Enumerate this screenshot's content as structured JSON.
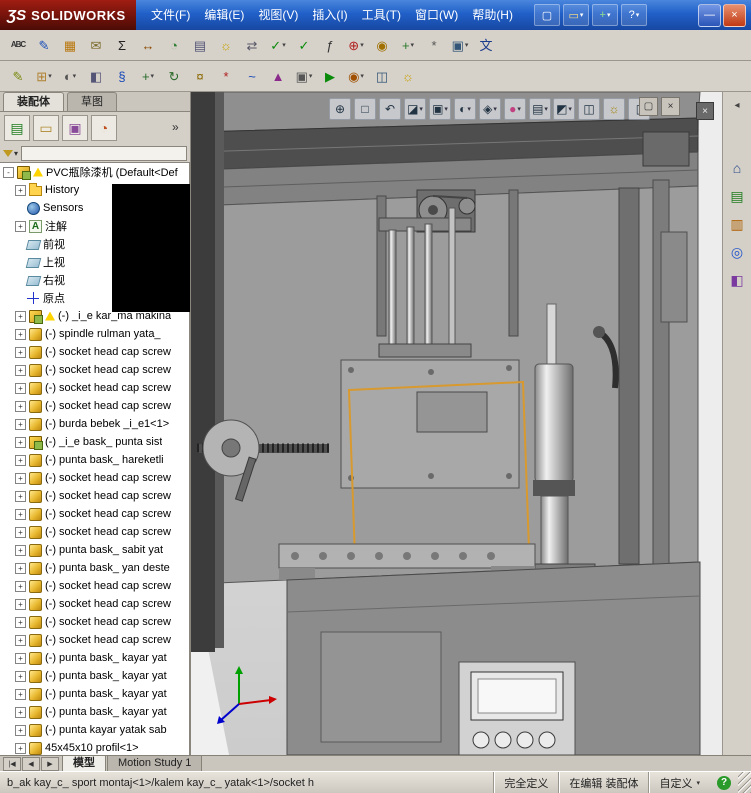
{
  "app": {
    "logo_mark": "ƷS",
    "logo_text": "SOLIDWORKS"
  },
  "title_bar": {
    "menus": [
      "文件(F)",
      "编辑(E)",
      "视图(V)",
      "插入(I)",
      "工具(T)",
      "窗口(W)",
      "帮助(H)"
    ],
    "quick_icons": [
      {
        "name": "new-document-icon",
        "glyph": "▢",
        "fg": "#ffffff"
      },
      {
        "name": "open-document-icon",
        "glyph": "▭",
        "fg": "#ffe080",
        "dd": true
      },
      {
        "name": "toolbox-icon",
        "glyph": "+",
        "fg": "#8fe08f",
        "dd": true
      },
      {
        "name": "help-icon",
        "glyph": "?",
        "fg": "#ffffff",
        "dd": true
      }
    ],
    "window_buttons": [
      {
        "name": "minimize-button",
        "glyph": "—"
      },
      {
        "name": "close-button",
        "glyph": "×",
        "close": true
      }
    ]
  },
  "toolbars": {
    "row1": [
      {
        "name": "spell-check-icon",
        "glyph": "ABC",
        "fg": "#333333",
        "cls": "small"
      },
      {
        "name": "sketch-icon",
        "glyph": "✎",
        "fg": "#1d4fb8"
      },
      {
        "name": "design-table-icon",
        "glyph": "▦",
        "fg": "#b9770e"
      },
      {
        "name": "publish-edrawing-icon",
        "glyph": "✉",
        "fg": "#7a6a2a"
      },
      {
        "name": "equations-icon",
        "glyph": "Σ",
        "fg": "#222222"
      },
      {
        "name": "measure-icon",
        "glyph": "↔",
        "fg": "#8a4a00"
      },
      {
        "name": "mass-properties-icon",
        "glyph": "◔",
        "fg": "#2e7d32"
      },
      {
        "name": "section-properties-icon",
        "glyph": "▤",
        "fg": "#555577"
      },
      {
        "name": "lights-icon",
        "glyph": "☼",
        "fg": "#c8a000"
      },
      {
        "name": "reorder-icon",
        "glyph": "⇄",
        "fg": "#555566"
      },
      {
        "name": "design-check-icon",
        "glyph": "✓",
        "fg": "#0a8a0a",
        "dd": true
      },
      {
        "name": "verify-sketch-icon",
        "glyph": "✓",
        "fg": "#0a8a0a"
      },
      {
        "name": "statistics-icon",
        "glyph": "ƒ",
        "fg": "#333333"
      },
      {
        "name": "simulation-icon",
        "glyph": "⊕",
        "fg": "#b02020",
        "dd": true
      },
      {
        "name": "sensor-icon",
        "glyph": "◉",
        "fg": "#a07000"
      },
      {
        "name": "move-face-icon",
        "glyph": "+",
        "fg": "#2a7a2a",
        "dd": true
      },
      {
        "name": "options-gear-icon",
        "glyph": "*",
        "fg": "#555555"
      },
      {
        "name": "deviation-icon",
        "glyph": "▣",
        "fg": "#335577",
        "dd": true
      },
      {
        "name": "language-icon",
        "glyph": "文",
        "fg": "#1a3a8a"
      }
    ],
    "row2": [
      {
        "name": "edit-component-icon",
        "glyph": "✎",
        "fg": "#7a8a10"
      },
      {
        "name": "insert-component-icon",
        "glyph": "⊞",
        "fg": "#b08030",
        "dd": true
      },
      {
        "name": "hide-component-icon",
        "glyph": "◐",
        "fg": "#555555",
        "dd": true
      },
      {
        "name": "component-transparency-icon",
        "glyph": "◧",
        "fg": "#555577"
      },
      {
        "name": "mate-icon",
        "glyph": "§",
        "fg": "#1a4ab8"
      },
      {
        "name": "move-component-icon",
        "glyph": "+",
        "fg": "#2a6a2a",
        "dd": true
      },
      {
        "name": "rotate-component-icon",
        "glyph": "↻",
        "fg": "#2a6a2a"
      },
      {
        "name": "smart-fasteners-icon",
        "glyph": "¤",
        "fg": "#8a6a00"
      },
      {
        "name": "exploded-view-icon",
        "glyph": "*",
        "fg": "#b02020"
      },
      {
        "name": "explode-lines-icon",
        "glyph": "~",
        "fg": "#1a4ab8"
      },
      {
        "name": "interference-detection-icon",
        "glyph": "▲",
        "fg": "#8a2a8a"
      },
      {
        "name": "assembly-features-icon",
        "glyph": "▣",
        "fg": "#555555",
        "dd": true
      },
      {
        "name": "motion-study-icon",
        "glyph": "▶",
        "fg": "#0a8a0a"
      },
      {
        "name": "physical-simulation-icon",
        "glyph": "◉",
        "fg": "#a05000",
        "dd": true
      },
      {
        "name": "camera-view-icon",
        "glyph": "◫",
        "fg": "#335577"
      },
      {
        "name": "scene-light-icon",
        "glyph": "☼",
        "fg": "#c8a000"
      }
    ]
  },
  "left_panel": {
    "tabs": [
      {
        "label": "装配体",
        "active": true
      },
      {
        "label": "草图",
        "active": false
      }
    ],
    "manager_tabs": [
      {
        "name": "featuremanager-tree-tab",
        "glyph": "▤",
        "fg": "#1e7d1e"
      },
      {
        "name": "propertymanager-tab",
        "glyph": "▭",
        "fg": "#b08a30"
      },
      {
        "name": "configurationmanager-tab",
        "glyph": "▣",
        "fg": "#8a4a9a"
      },
      {
        "name": "dimxpert-tab",
        "glyph": "◔",
        "fg": "#c05020"
      }
    ],
    "chevron": "»",
    "filter": {
      "dd": "▾"
    },
    "tree": {
      "items": [
        {
          "ind": "ind0",
          "expc": "ebox",
          "exp": "-",
          "icon": "assembly",
          "warn": true,
          "label": "PVC瓶除漆机  (Default<Def"
        },
        {
          "ind": "ind1",
          "expc": "ebox",
          "exp": "+",
          "icon": "folder",
          "label": "History"
        },
        {
          "ind": "ind1",
          "expc": "enone",
          "exp": "",
          "icon": "sensors",
          "label": "Sensors"
        },
        {
          "ind": "ind1",
          "expc": "ebox",
          "exp": "+",
          "icon": "annotation",
          "label": "注解"
        },
        {
          "ind": "ind1",
          "expc": "enone",
          "exp": "",
          "icon": "plane",
          "label": "前视"
        },
        {
          "ind": "ind1",
          "expc": "enone",
          "exp": "",
          "icon": "plane",
          "label": "上视"
        },
        {
          "ind": "ind1",
          "expc": "enone",
          "exp": "",
          "icon": "plane",
          "label": "右视"
        },
        {
          "ind": "ind1",
          "expc": "enone",
          "exp": "",
          "icon": "origin",
          "label": "原点"
        },
        {
          "ind": "ind1",
          "expc": "ebox",
          "exp": "+",
          "icon": "assembly",
          "warn": true,
          "label": "(-) _i_e kar_ma makina"
        },
        {
          "ind": "ind1",
          "expc": "ebox",
          "exp": "+",
          "icon": "part",
          "label": "(-) spindle rulman yata_"
        },
        {
          "ind": "ind1",
          "expc": "ebox",
          "exp": "+",
          "icon": "part",
          "label": "(-) socket head cap screw"
        },
        {
          "ind": "ind1",
          "expc": "ebox",
          "exp": "+",
          "icon": "part",
          "label": "(-) socket head cap screw"
        },
        {
          "ind": "ind1",
          "expc": "ebox",
          "exp": "+",
          "icon": "part",
          "label": "(-) socket head cap screw"
        },
        {
          "ind": "ind1",
          "expc": "ebox",
          "exp": "+",
          "icon": "part",
          "label": "(-) socket head cap screw"
        },
        {
          "ind": "ind1",
          "expc": "ebox",
          "exp": "+",
          "icon": "part",
          "label": "(-) burda bebek _i_e1<1>"
        },
        {
          "ind": "ind1",
          "expc": "ebox",
          "exp": "+",
          "icon": "assembly",
          "label": "(-) _i_e bask_ punta sist"
        },
        {
          "ind": "ind1",
          "expc": "ebox",
          "exp": "+",
          "icon": "part",
          "label": "(-) punta bask_ hareketli"
        },
        {
          "ind": "ind1",
          "expc": "ebox",
          "exp": "+",
          "icon": "part",
          "label": "(-) socket head cap screw"
        },
        {
          "ind": "ind1",
          "expc": "ebox",
          "exp": "+",
          "icon": "part",
          "label": "(-) socket head cap screw"
        },
        {
          "ind": "ind1",
          "expc": "ebox",
          "exp": "+",
          "icon": "part",
          "label": "(-) socket head cap screw"
        },
        {
          "ind": "ind1",
          "expc": "ebox",
          "exp": "+",
          "icon": "part",
          "label": "(-) socket head cap screw"
        },
        {
          "ind": "ind1",
          "expc": "ebox",
          "exp": "+",
          "icon": "part",
          "label": "(-) punta bask_ sabit yat"
        },
        {
          "ind": "ind1",
          "expc": "ebox",
          "exp": "+",
          "icon": "part",
          "label": "(-) punta bask_ yan deste"
        },
        {
          "ind": "ind1",
          "expc": "ebox",
          "exp": "+",
          "icon": "part",
          "label": "(-) socket head cap screw"
        },
        {
          "ind": "ind1",
          "expc": "ebox",
          "exp": "+",
          "icon": "part",
          "label": "(-) socket head cap screw"
        },
        {
          "ind": "ind1",
          "expc": "ebox",
          "exp": "+",
          "icon": "part",
          "label": "(-) socket head cap screw"
        },
        {
          "ind": "ind1",
          "expc": "ebox",
          "exp": "+",
          "icon": "part",
          "label": "(-) socket head cap screw"
        },
        {
          "ind": "ind1",
          "expc": "ebox",
          "exp": "+",
          "icon": "part",
          "label": "(-) punta bask_ kayar yat"
        },
        {
          "ind": "ind1",
          "expc": "ebox",
          "exp": "+",
          "icon": "part",
          "label": "(-) punta bask_ kayar yat"
        },
        {
          "ind": "ind1",
          "expc": "ebox",
          "exp": "+",
          "icon": "part",
          "label": "(-) punta bask_ kayar yat"
        },
        {
          "ind": "ind1",
          "expc": "ebox",
          "exp": "+",
          "icon": "part",
          "label": "(-) punta bask_ kayar yat"
        },
        {
          "ind": "ind1",
          "expc": "ebox",
          "exp": "+",
          "icon": "part",
          "label": "(-) punta kayar yatak sab"
        },
        {
          "ind": "ind1",
          "expc": "ebox",
          "exp": "+",
          "icon": "part",
          "label": "45x45x10 profil<1>"
        }
      ]
    }
  },
  "viewport": {
    "hud": [
      {
        "name": "zoom-fit-icon",
        "glyph": "⊕"
      },
      {
        "name": "zoom-area-icon",
        "glyph": "□"
      },
      {
        "name": "previous-view-icon",
        "glyph": "↶"
      },
      {
        "name": "section-view-icon",
        "glyph": "◪",
        "dd": true
      },
      {
        "name": "view-orientation-icon",
        "glyph": "▣",
        "dd": true
      },
      {
        "name": "display-style-icon",
        "glyph": "◐",
        "dd": true
      },
      {
        "name": "hide-show-items-icon",
        "glyph": "◈",
        "dd": true
      },
      {
        "name": "edit-appearance-icon",
        "glyph": "●",
        "fg": "#c04080",
        "dd": true
      },
      {
        "name": "apply-scene-icon",
        "glyph": "▤",
        "dd": true
      }
    ],
    "hud_right": [
      {
        "name": "view-settings-icon",
        "glyph": "◩",
        "dd": true
      },
      {
        "name": "camera-icon",
        "glyph": "◫"
      },
      {
        "name": "scene-lights-icon",
        "glyph": "☼",
        "fg": "#a08000"
      },
      {
        "name": "task-pane-toggle-icon",
        "glyph": "▯"
      }
    ],
    "doc_buttons": [
      {
        "name": "restore-document-button",
        "glyph": "▢"
      },
      {
        "name": "close-document-button",
        "glyph": "×"
      }
    ],
    "pane_close_glyph": "×"
  },
  "task_pane": {
    "collapse_glyph": "◂",
    "icons": [
      {
        "name": "home-icon",
        "glyph": "⌂",
        "fg": "#2a4a8a"
      },
      {
        "name": "design-library-icon",
        "glyph": "▤",
        "fg": "#1e7d1e"
      },
      {
        "name": "file-explorer-icon",
        "glyph": "▥",
        "fg": "#b06000"
      },
      {
        "name": "search-icon",
        "glyph": "◎",
        "fg": "#2255cc"
      },
      {
        "name": "view-palette-icon",
        "glyph": "◧",
        "fg": "#7a3aa0"
      }
    ]
  },
  "model_tabs": {
    "nav": [
      {
        "name": "first-tab-button",
        "glyph": "|◀"
      },
      {
        "name": "prev-tab-button",
        "glyph": "◀"
      },
      {
        "name": "next-tab-button",
        "glyph": "▶"
      }
    ],
    "tabs": [
      {
        "label": "模型",
        "active": true
      },
      {
        "label": "Motion Study 1",
        "active": false
      }
    ]
  },
  "status_bar": {
    "path": "b_ak kay_c_  sport montaj<1>/kalem kay_c_  yatak<1>/socket h",
    "defined": "完全定义",
    "mode": "在编辑 装配体",
    "custom": "自定义",
    "custom_dd": "▾",
    "help_glyph": "?"
  },
  "colors": {
    "titlebar_blue": "#2160c8",
    "logo_red": "#8c1713",
    "selection_orange": "#d8992e",
    "toolbar_gray": "#d6d2ca",
    "warning_yellow": "#ffd400"
  }
}
